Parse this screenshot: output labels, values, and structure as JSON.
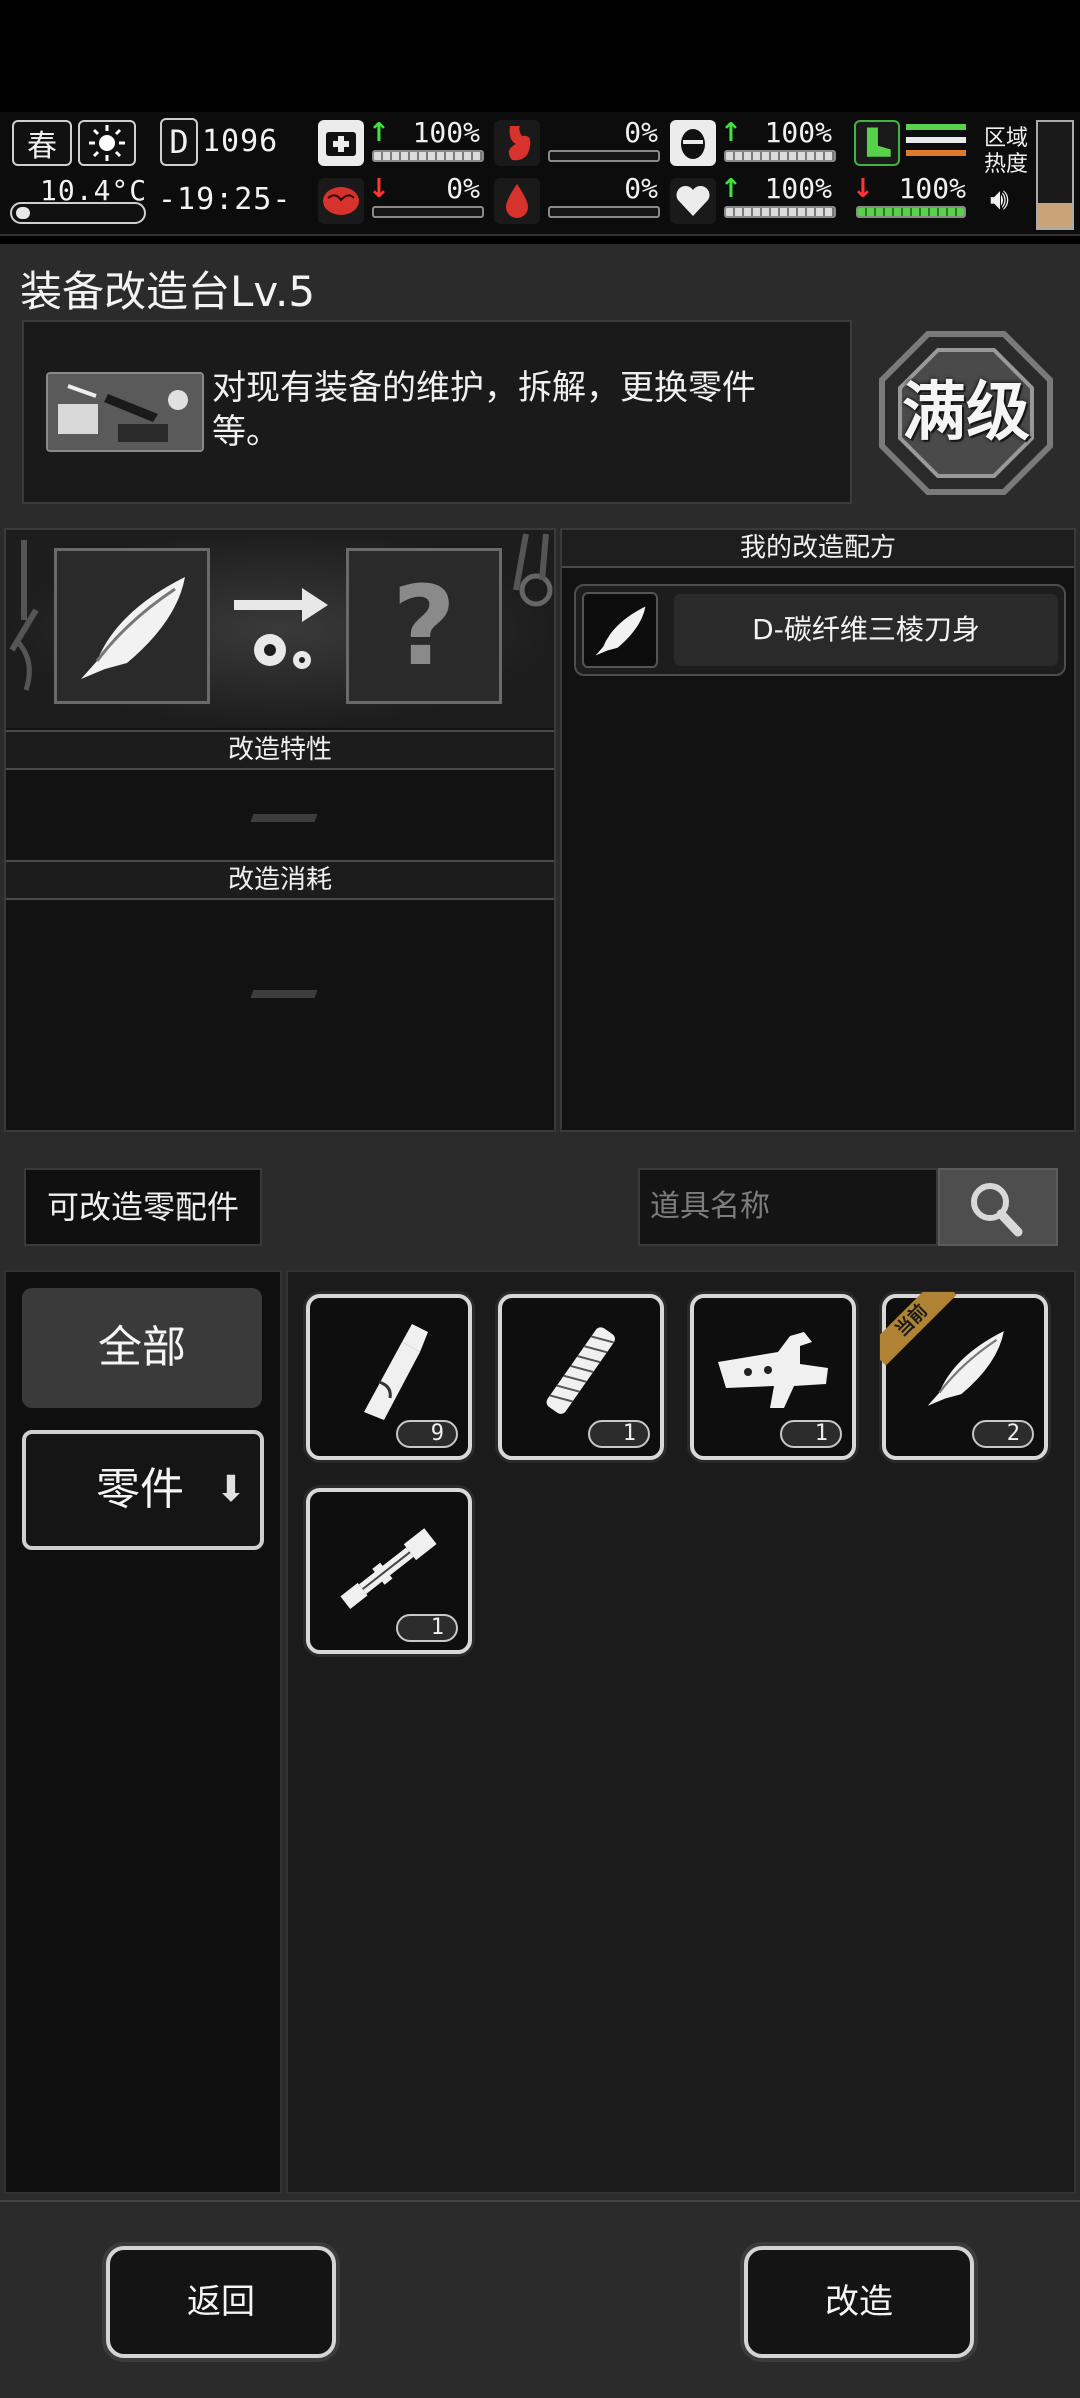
{
  "hud": {
    "season": "春",
    "day": "1096",
    "temperature": "10.4°C",
    "time": "-19:25-",
    "health_pct": "100%",
    "brain_pct": "0%",
    "stomach_pct": "0%",
    "blood_pct": "0%",
    "armor_pct": "100%",
    "heart_pct": "100%",
    "stamina_pct": "100%",
    "region_label_1": "区域",
    "region_label_2": "热度",
    "progress": {
      "health": 1.0,
      "brain": 0.0,
      "stomach": 0.0,
      "blood": 0.0,
      "armor": 1.0,
      "heart": 1.0,
      "stamina": 1.0
    },
    "accent_colors": {
      "up_arrow": "#3fe13f",
      "down_arrow": "#ff3535",
      "stamina_green": "#58d24a"
    }
  },
  "page": {
    "title": "装备改造台Lv.5",
    "description": "对现有装备的维护，拆解，更换零件等。",
    "max_level_badge": "满级"
  },
  "craft": {
    "input_slot_icon": "curved-blade-icon",
    "result_placeholder": "?",
    "traits_header": "改造特性",
    "cost_header": "改造消耗"
  },
  "recipes": {
    "header": "我的改造配方",
    "items": [
      {
        "name": "D-碳纤维三棱刀身",
        "icon": "curved-blade-icon"
      }
    ]
  },
  "filter": {
    "label": "可改造零配件",
    "search_placeholder": "道具名称"
  },
  "categories": [
    {
      "label": "全部"
    },
    {
      "label": "零件"
    }
  ],
  "items": [
    {
      "icon": "wooden-handle-icon",
      "count": "9"
    },
    {
      "icon": "wrapped-grip-icon",
      "count": "1"
    },
    {
      "icon": "trigger-mechanism-icon",
      "count": "1"
    },
    {
      "icon": "curved-blade-icon",
      "count": "2",
      "badge": "当前"
    },
    {
      "icon": "scope-tube-icon",
      "count": "1"
    }
  ],
  "buttons": {
    "back": "返回",
    "modify": "改造"
  }
}
